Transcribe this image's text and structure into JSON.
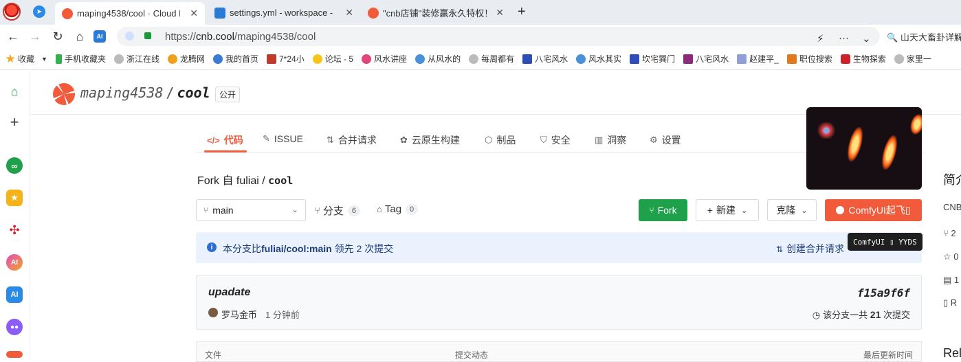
{
  "browser": {
    "tabs": [
      {
        "label": "maping4538/cool · Cloud N",
        "active": true
      },
      {
        "label": "settings.yml - workspace - ",
        "active": false
      },
      {
        "label": "\"cnb店铺\"装修赢永久特权！这",
        "active": false
      }
    ],
    "new_tab": "+",
    "url_prefix": "https://",
    "url_host": "cnb.cool",
    "url_path": "/maping4538/cool",
    "search_snippet": "山天大畜卦详解",
    "bookmarks": [
      "收藏",
      "手机收藏夹",
      "浙江在线",
      "龙腾网",
      "我的首页",
      "7*24小",
      "论坛 - 5",
      "风水讲座",
      "从风水的",
      "每周都有",
      "八宅风水",
      "风水其实",
      "坎宅巽门",
      "八宅风水",
      "赵建平_",
      "职位搜索",
      "生物探索",
      "家里一"
    ],
    "colors": {
      "accent": "#f15a3a",
      "fork_green": "#1fa04a",
      "info_blue": "#2b6fd6"
    }
  },
  "repo": {
    "owner": "maping4538",
    "sep": "/",
    "name": "cool",
    "visibility": "公开",
    "tabs": [
      {
        "icon": "</>",
        "label": "代码",
        "active": true
      },
      {
        "icon": "✎",
        "label": "ISSUE"
      },
      {
        "icon": "⇅",
        "label": "合并请求"
      },
      {
        "icon": "✿",
        "label": "云原生构建"
      },
      {
        "icon": "⬡",
        "label": "制品"
      },
      {
        "icon": "⛉",
        "label": "安全"
      },
      {
        "icon": "▥",
        "label": "洞察"
      },
      {
        "icon": "⚙",
        "label": "设置"
      }
    ],
    "fork_prefix": "Fork 自 fuliai / ",
    "fork_name": "cool"
  },
  "toolbar": {
    "branch": "main",
    "branches_label": "分支",
    "branches_count": "6",
    "tags_label": "Tag",
    "tags_count": "0",
    "fork_button": "Fork",
    "new_button": "新建",
    "clone_button": "克隆",
    "comfy_button": "ComfyUI起飞▯",
    "tooltip": "ComfyUI ▯ YYDS"
  },
  "banner": {
    "prefix": "本分支比",
    "ref": "fuliai/cool:main",
    "suffix": "领先 2 次提交",
    "create_pr": "创建合并请求"
  },
  "commit": {
    "message": "upadate",
    "hash": "f15a9f6f",
    "author": "罗马金币",
    "time": "1 分钟前",
    "count_prefix": "该分支一共",
    "count": "21",
    "count_suffix": "次提交"
  },
  "files": {
    "col_file": "文件",
    "col_activity": "提交动态",
    "col_updated": "最后更新时间"
  },
  "sidebar": {
    "title": "简介",
    "lines": [
      "CNB",
      "2",
      "0",
      "1",
      "R"
    ],
    "footer": "Rele"
  }
}
